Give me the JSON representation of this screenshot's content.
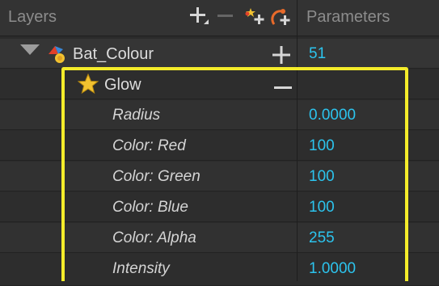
{
  "header": {
    "layers_title": "Layers",
    "parameters_title": "Parameters",
    "toolbar": [
      {
        "icon": "add-layer-icon"
      },
      {
        "icon": "remove-layer-icon"
      },
      {
        "icon": "add-effect-icon"
      },
      {
        "icon": "add-mask-icon"
      }
    ]
  },
  "layer": {
    "name": "Bat_Colour",
    "value": "51",
    "icon": "bat-colour-layer-icon",
    "toggle_icon": "plus-icon"
  },
  "effect": {
    "name": "Glow",
    "icon": "star-icon",
    "toggle_icon": "minus-icon"
  },
  "parameters": [
    {
      "label": "Radius",
      "value": "0.0000"
    },
    {
      "label": "Color: Red",
      "value": "100"
    },
    {
      "label": "Color: Green",
      "value": "100"
    },
    {
      "label": "Color: Blue",
      "value": "100"
    },
    {
      "label": "Color: Alpha",
      "value": "255"
    },
    {
      "label": "Intensity",
      "value": "1.0000"
    }
  ],
  "colors": {
    "value_text": "#2cc4ee",
    "highlight": "#f4ec2a",
    "background": "#2b2b2b"
  }
}
